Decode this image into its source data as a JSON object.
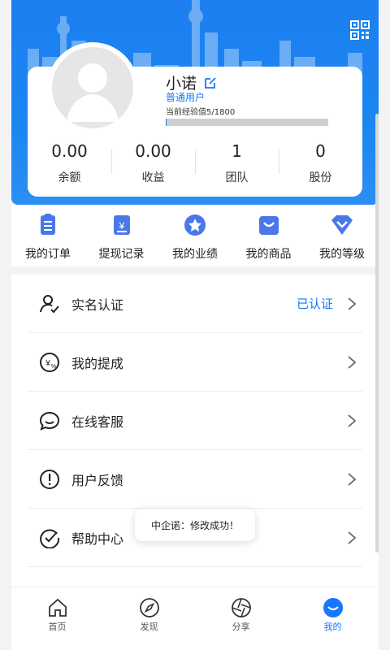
{
  "header": {
    "qr_icon": "qr-code-icon",
    "brand_color": "#1a86f2"
  },
  "profile": {
    "username": "小诺",
    "edit_icon": "edit-icon",
    "level": "普通用户",
    "exp_label": "当前经验值5/1800",
    "exp_progress": 0.003
  },
  "stats": [
    {
      "value": "0.00",
      "label": "余额"
    },
    {
      "value": "0.00",
      "label": "收益"
    },
    {
      "value": "1",
      "label": "团队"
    },
    {
      "value": "0",
      "label": "股份"
    }
  ],
  "quick_actions": [
    {
      "label": "我的订单",
      "icon": "order-icon"
    },
    {
      "label": "提现记录",
      "icon": "withdraw-icon"
    },
    {
      "label": "我的业绩",
      "icon": "star-badge-icon"
    },
    {
      "label": "我的商品",
      "icon": "bag-icon"
    },
    {
      "label": "我的等级",
      "icon": "diamond-icon"
    }
  ],
  "menu": [
    {
      "label": "实名认证",
      "status": "已认证",
      "icon": "user-check-icon"
    },
    {
      "label": "我的提成",
      "status": "",
      "icon": "commission-icon"
    },
    {
      "label": "在线客服",
      "status": "",
      "icon": "chat-icon"
    },
    {
      "label": "用户反馈",
      "status": "",
      "icon": "alert-icon"
    },
    {
      "label": "帮助中心",
      "status": "",
      "icon": "check-circle-icon"
    }
  ],
  "toast": {
    "message": "中企诺：修改成功！"
  },
  "tabbar": [
    {
      "label": "首页",
      "icon": "home-icon",
      "active": false
    },
    {
      "label": "发现",
      "icon": "compass-icon",
      "active": false
    },
    {
      "label": "分享",
      "icon": "share-icon",
      "active": false
    },
    {
      "label": "我的",
      "icon": "profile-icon",
      "active": true
    }
  ]
}
